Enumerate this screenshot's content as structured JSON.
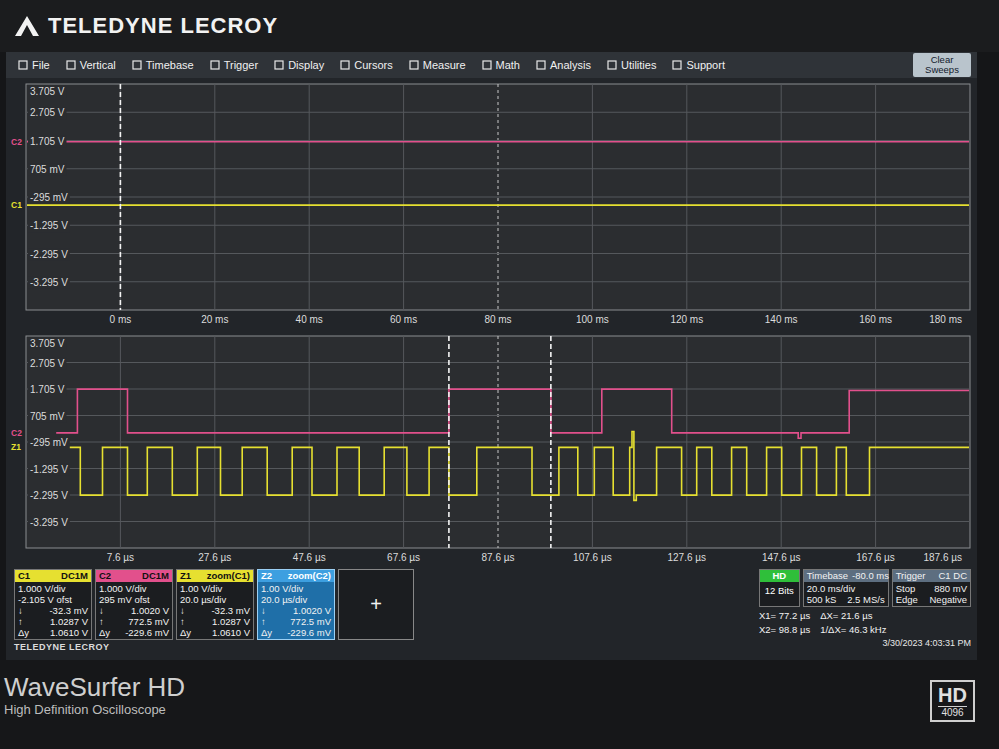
{
  "brand": "TELEDYNE LECROY",
  "menu": [
    "File",
    "Vertical",
    "Timebase",
    "Trigger",
    "Display",
    "Cursors",
    "Measure",
    "Math",
    "Analysis",
    "Utilities",
    "Support"
  ],
  "clear_button": "Clear Sweeps",
  "charts": [
    {
      "x_ticks": [
        "0 ms",
        "20 ms",
        "40 ms",
        "60 ms",
        "80 ms",
        "100 ms",
        "120 ms",
        "140 ms",
        "160 ms",
        "180 ms"
      ],
      "y_ticks": [
        "3.705 V",
        "2.705 V",
        "1.705 V",
        "705 mV",
        "-295 mV",
        "-1.295 V",
        "-2.295 V",
        "-3.295 V"
      ],
      "t_min": -20,
      "t_max": 180,
      "v_top": 3.705,
      "v_bottom": -4.295,
      "cursors": [
        0
      ],
      "series": [
        {
          "tag": "C2",
          "color": "#e2508c",
          "points": [
            [
              -20,
              1.66
            ],
            [
              180,
              1.66
            ]
          ]
        },
        {
          "tag": "C1",
          "color": "#e6e030",
          "points": [
            [
              -20,
              -0.58
            ],
            [
              180,
              -0.58
            ]
          ]
        }
      ]
    },
    {
      "x_ticks": [
        "7.6 µs",
        "27.6 µs",
        "47.6 µs",
        "67.6 µs",
        "87.6 µs",
        "107.6 µs",
        "127.6 µs",
        "147.6 µs",
        "167.6 µs",
        "187.6 µs"
      ],
      "y_ticks": [
        "3.705 V",
        "2.705 V",
        "1.705 V",
        "705 mV",
        "-295 mV",
        "-1.295 V",
        "-2.295 V",
        "-3.295 V"
      ],
      "t_min": -12.4,
      "t_max": 187.6,
      "v_top": 3.705,
      "v_bottom": -4.295,
      "cursors": [
        77.2,
        98.8
      ],
      "series": [
        {
          "tag": "C2",
          "color": "#e2508c",
          "points": [
            [
              -6,
              0.05
            ],
            [
              -1.5,
              1.7
            ],
            [
              9.1,
              0.05
            ],
            [
              77.2,
              1.7
            ],
            [
              98.8,
              0.05
            ],
            [
              109.6,
              1.7
            ],
            [
              124.4,
              0.05
            ],
            [
              151.2,
              -0.15
            ],
            [
              151.8,
              0.05
            ],
            [
              162.0,
              1.65
            ],
            [
              187.6,
              1.65
            ]
          ]
        },
        {
          "tag": "Z1",
          "color": "#e6e030",
          "points": [
            [
              -6,
              -0.5
            ],
            [
              -0.9,
              -2.3
            ],
            [
              3.8,
              -0.5
            ],
            [
              9.1,
              -2.3
            ],
            [
              13.3,
              -0.5
            ],
            [
              18.6,
              -2.3
            ],
            [
              23.9,
              -0.5
            ],
            [
              28.8,
              -2.3
            ],
            [
              33.4,
              -0.5
            ],
            [
              38.7,
              -2.3
            ],
            [
              44.0,
              -0.5
            ],
            [
              48.2,
              -2.3
            ],
            [
              53.5,
              -0.5
            ],
            [
              58.2,
              -2.3
            ],
            [
              63.5,
              -0.5
            ],
            [
              68.3,
              -2.3
            ],
            [
              73.0,
              -0.5
            ],
            [
              77.2,
              -2.3
            ],
            [
              83.1,
              -0.5
            ],
            [
              94.8,
              -2.3
            ],
            [
              100.5,
              -0.5
            ],
            [
              104.5,
              -2.3
            ],
            [
              108.0,
              -0.5
            ],
            [
              112.0,
              -2.3
            ],
            [
              115.5,
              -0.5
            ],
            [
              116.0,
              0.1
            ],
            [
              116.4,
              -2.5
            ],
            [
              116.9,
              -2.3
            ],
            [
              121.2,
              -0.5
            ],
            [
              126.5,
              -2.3
            ],
            [
              129.7,
              -0.5
            ],
            [
              132.9,
              -2.3
            ],
            [
              137.1,
              -0.5
            ],
            [
              140.3,
              -2.3
            ],
            [
              144.5,
              -0.5
            ],
            [
              147.7,
              -2.3
            ],
            [
              151.9,
              -0.5
            ],
            [
              155.1,
              -2.3
            ],
            [
              159.3,
              -0.5
            ],
            [
              161.4,
              -2.3
            ],
            [
              166.3,
              -0.5
            ],
            [
              187.6,
              -0.5
            ]
          ]
        }
      ]
    }
  ],
  "descriptors": [
    {
      "title": "C1",
      "coupling": "DC1M",
      "color": "#e6e030",
      "selected": false,
      "rows": [
        {
          "v": "1.000 V/div"
        },
        {
          "v": "-2.105 V ofst"
        },
        {
          "k": "↓",
          "v": "-32.3 mV"
        },
        {
          "k": "↑",
          "v": "1.0287 V"
        },
        {
          "k": "Δy",
          "v": "1.0610 V"
        }
      ]
    },
    {
      "title": "C2",
      "coupling": "DC1M",
      "color": "#e2508c",
      "selected": false,
      "rows": [
        {
          "v": "1.000 V/div"
        },
        {
          "v": "295 mV ofst"
        },
        {
          "k": "↓",
          "v": "1.0020 V"
        },
        {
          "k": "↑",
          "v": "772.5 mV"
        },
        {
          "k": "Δy",
          "v": "-229.6 mV"
        }
      ]
    },
    {
      "title": "Z1",
      "coupling": "zoom(C1)",
      "color": "#e6e030",
      "selected": false,
      "rows": [
        {
          "v": "1.00 V/div"
        },
        {
          "v": "20.0 µs/div"
        },
        {
          "k": "↓",
          "v": "-32.3 mV"
        },
        {
          "k": "↑",
          "v": "1.0287 V"
        },
        {
          "k": "Δy",
          "v": "1.0610 V"
        }
      ]
    },
    {
      "title": "Z2",
      "coupling": "zoom(C2)",
      "color": "#3d9fe0",
      "selected": true,
      "rows": [
        {
          "v": "1.00 V/div"
        },
        {
          "v": "20.0 µs/div"
        },
        {
          "k": "↓",
          "v": "1.0020 V"
        },
        {
          "k": "↑",
          "v": "772.5 mV"
        },
        {
          "k": "Δy",
          "v": "-229.6 mV"
        }
      ]
    }
  ],
  "add_button": "+",
  "footer_brand": "TELEDYNE LECROY",
  "acquisition": {
    "badge": "HD",
    "bits": "12 Bits"
  },
  "timebase": {
    "title": "Timebase",
    "value": "-80.0 ms",
    "rows": [
      {
        "v": "20.0 ms/div"
      },
      {
        "k": "500 kS",
        "v": "2.5 MS/s"
      }
    ]
  },
  "trigger": {
    "title": "Trigger",
    "value": "C1 DC",
    "rows": [
      {
        "k": "Stop",
        "v": "880 mV"
      },
      {
        "k": "Edge",
        "v": "Negative"
      }
    ]
  },
  "cursor_readout": [
    [
      "X1= 77.2 µs",
      "ΔX= 21.6 µs"
    ],
    [
      "X2= 98.8 µs",
      "1/ΔX= 46.3 kHz"
    ]
  ],
  "datetime": "3/30/2023 4:03:31 PM",
  "bezel": {
    "model": "WaveSurfer HD",
    "subtitle": "High Definition Oscilloscope",
    "badge": "HD",
    "badge_sub": "4096"
  }
}
